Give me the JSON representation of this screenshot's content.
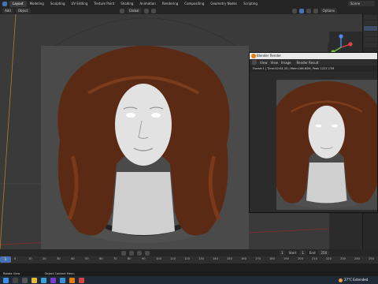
{
  "menu": {
    "tabs": [
      "Layout",
      "Modeling",
      "Sculpting",
      "UV Editing",
      "Texture Paint",
      "Shading",
      "Animation",
      "Rendering",
      "Compositing",
      "Geometry Nodes",
      "Scripting"
    ],
    "active_tab": "Layout",
    "scene": "Scene"
  },
  "header": {
    "add": "Add",
    "object": "Object",
    "transform": "Global",
    "options": "Options"
  },
  "render_window": {
    "title": "Blender Render",
    "toolbar": [
      "View",
      "View",
      "Image",
      "Render Result"
    ],
    "info": "Frame:1 | Time:00:04.33 | Mem:166.60M, Peak 1222.17M"
  },
  "timeline": {
    "frame_labels": [
      "0",
      "10",
      "20",
      "30",
      "40",
      "50",
      "60",
      "70",
      "80",
      "90",
      "100",
      "110",
      "120",
      "130",
      "140",
      "150",
      "160",
      "170",
      "180",
      "190",
      "200",
      "210",
      "220",
      "230",
      "240",
      "250"
    ],
    "current_frame": "1",
    "start_label": "Start",
    "start_value": "1",
    "end_label": "End",
    "end_value": "250"
  },
  "status": {
    "left": "Rotate View",
    "middle": "Object Context Menu"
  },
  "taskbar": {
    "weather": "27°C  Extended"
  },
  "colors": {
    "accent": "#4772b3",
    "hair": "#5a2a14",
    "skin": "#e2e2e2",
    "blender_orange": "#e87d0d"
  }
}
